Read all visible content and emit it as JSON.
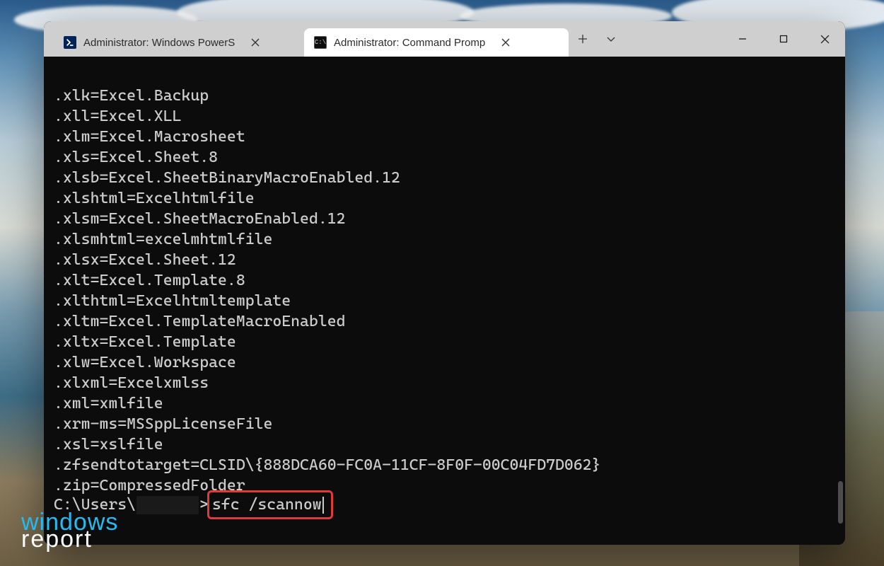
{
  "tabs": [
    {
      "label": "Administrator: Windows PowerS",
      "icon": "powershell",
      "active": false
    },
    {
      "label": "Administrator: Command Promp",
      "icon": "cmd",
      "active": true
    }
  ],
  "output_lines": [
    ".xlk=Excel.Backup",
    ".xll=Excel.XLL",
    ".xlm=Excel.Macrosheet",
    ".xls=Excel.Sheet.8",
    ".xlsb=Excel.SheetBinaryMacroEnabled.12",
    ".xlshtml=Excelhtmlfile",
    ".xlsm=Excel.SheetMacroEnabled.12",
    ".xlsmhtml=excelmhtmlfile",
    ".xlsx=Excel.Sheet.12",
    ".xlt=Excel.Template.8",
    ".xlthtml=Excelhtmltemplate",
    ".xltm=Excel.TemplateMacroEnabled",
    ".xltx=Excel.Template",
    ".xlw=Excel.Workspace",
    ".xlxml=Excelxmlss",
    ".xml=xmlfile",
    ".xrm-ms=MSSppLicenseFile",
    ".xsl=xslfile",
    ".zfsendtotarget=CLSID\\{888DCA60-FC0A-11CF-8F0F-00C04FD7D062}",
    ".zip=CompressedFolder"
  ],
  "prompt": {
    "prefix": "C:\\Users\\",
    "suffix": ">",
    "command": "sfc /scannow"
  },
  "watermark": {
    "line1": "windows",
    "line2": "report"
  }
}
